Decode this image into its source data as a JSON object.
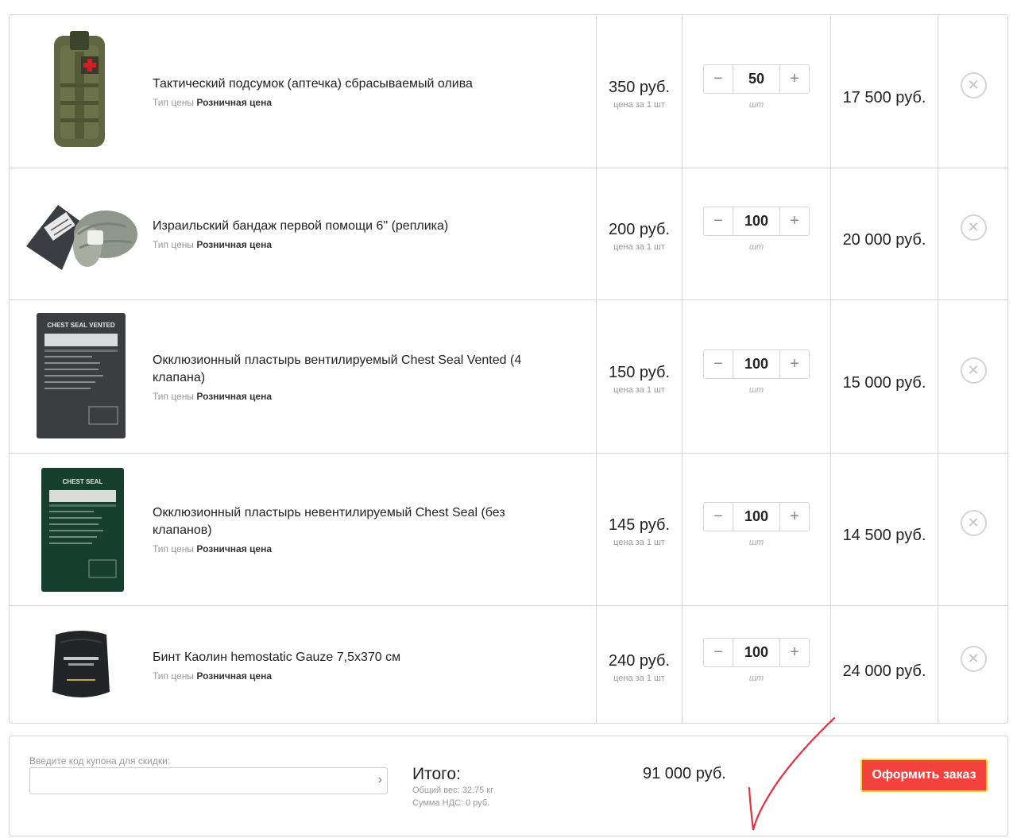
{
  "items": [
    {
      "name": "Тактический подсумок (аптечка) сбрасываемый олива",
      "price_type_label": "Тип цены",
      "price_type_value": "Розничная цена",
      "price": "350 руб.",
      "price_per": "цена за 1 шт",
      "quantity": "50",
      "unit": "шт",
      "total": "17 500 руб.",
      "image": "olive-medical-pouch-icon"
    },
    {
      "name": "Израильский бандаж первой помощи 6\" (реплика)",
      "price_type_label": "Тип цены",
      "price_type_value": "Розничная цена",
      "price": "200 руб.",
      "price_per": "цена за 1 шт",
      "quantity": "100",
      "unit": "шт",
      "total": "20 000 руб.",
      "image": "israeli-bandage-icon"
    },
    {
      "name": "Окклюзионный пластырь вентилируемый Chest Seal Vented (4 клапана)",
      "price_type_label": "Тип цены",
      "price_type_value": "Розничная цена",
      "price": "150 руб.",
      "price_per": "цена за 1 шт",
      "quantity": "100",
      "unit": "шт",
      "total": "15 000 руб.",
      "image": "chest-seal-vented-pack-icon",
      "image_text": "CHEST SEAL VENTED"
    },
    {
      "name": "Окклюзионный пластырь невентилируемый Chest Seal (без клапанов)",
      "price_type_label": "Тип цены",
      "price_type_value": "Розничная цена",
      "price": "145 руб.",
      "price_per": "цена за 1 шт",
      "quantity": "100",
      "unit": "шт",
      "total": "14 500 руб.",
      "image": "chest-seal-pack-icon",
      "image_text": "CHEST SEAL"
    },
    {
      "name": "Бинт Каолин hemostatic Gauze 7,5х370 см",
      "price_type_label": "Тип цены",
      "price_type_value": "Розничная цена",
      "price": "240 руб.",
      "price_per": "цена за 1 шт",
      "quantity": "100",
      "unit": "шт",
      "total": "24 000 руб.",
      "image": "hemostatic-gauze-pack-icon"
    }
  ],
  "controls": {
    "minus": "−",
    "plus": "+",
    "delete": "✕"
  },
  "summary": {
    "coupon_label": "Введите код купона для скидки:",
    "coupon_value": "",
    "coupon_arrow": "›",
    "total_title": "Итого:",
    "weight": "Общий вес: 32.75 кг",
    "vat": "Сумма НДС: 0 руб.",
    "total": "91 000 руб.",
    "checkout_label": "Оформить заказ"
  },
  "colors": {
    "accent": "#f4433f",
    "accent_border": "#ffcf33",
    "border": "#d4d4d4",
    "annotation": "#e5303f"
  }
}
